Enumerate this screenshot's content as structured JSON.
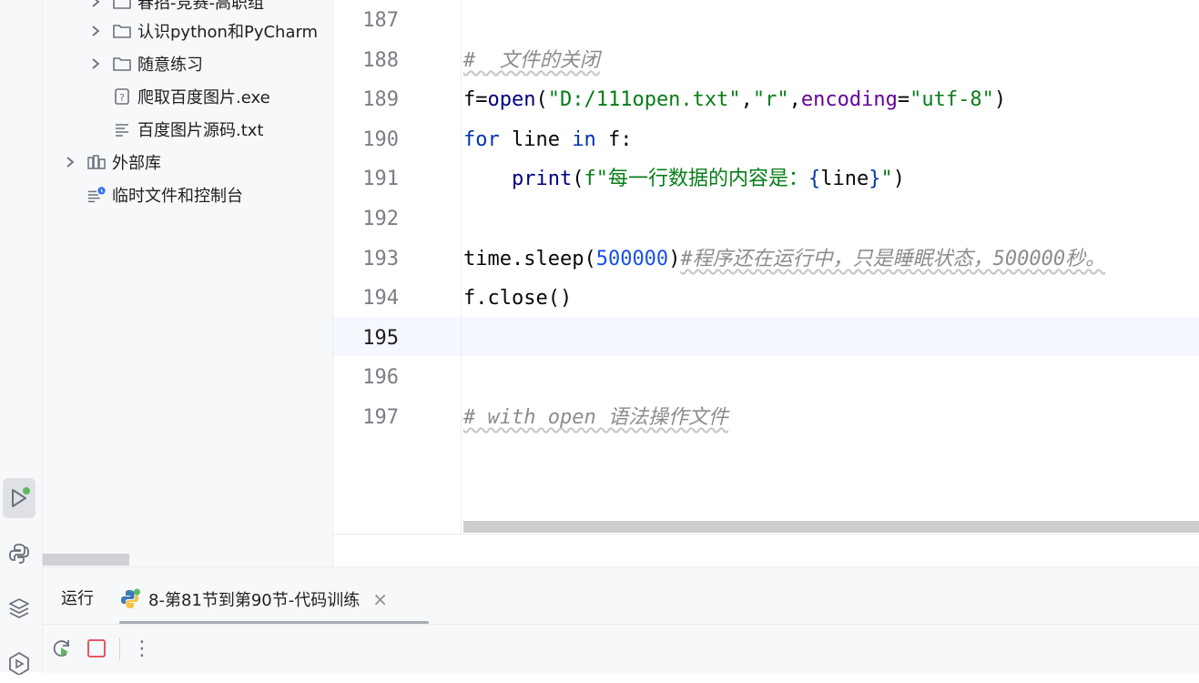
{
  "project_tree": {
    "items": [
      {
        "label": "春招-竞赛-高职组",
        "icon": "folder-icon",
        "expandable": true
      },
      {
        "label": "认识python和PyCharm",
        "icon": "folder-icon",
        "expandable": true
      },
      {
        "label": "随意练习",
        "icon": "folder-icon",
        "expandable": true
      },
      {
        "label": "爬取百度图片.exe",
        "icon": "unknown-file-icon",
        "expandable": false
      },
      {
        "label": "百度图片源码.txt",
        "icon": "text-file-icon",
        "expandable": false
      },
      {
        "label": "外部库",
        "icon": "library-icon",
        "expandable": true
      },
      {
        "label": "临时文件和控制台",
        "icon": "scratch-icon",
        "expandable": false
      }
    ]
  },
  "editor": {
    "line_numbers": [
      "187",
      "188",
      "189",
      "190",
      "191",
      "192",
      "193",
      "194",
      "195",
      "196",
      "197"
    ],
    "current_line": "195",
    "lines": {
      "l188_comment": "#  文件的关闭",
      "l189_a": "f=",
      "l189_open": "open",
      "l189_b": "(",
      "l189_s1": "\"D:/111open.txt\"",
      "l189_c1": ",",
      "l189_s2": "\"r\"",
      "l189_c2": ",",
      "l189_kw": "encoding",
      "l189_eq": "=",
      "l189_s3": "\"utf-8\"",
      "l189_end": ")",
      "l190_for": "for",
      "l190_mid": " line ",
      "l190_in": "in",
      "l190_end": " f:",
      "l191_indent": "    ",
      "l191_print": "print",
      "l191_p": "(",
      "l191_f1": "f\"每一行数据的内容是：",
      "l191_b1": "{",
      "l191_var": "line",
      "l191_b2": "}",
      "l191_f2": "\"",
      "l191_end": ")",
      "l193_a": "time.sleep(",
      "l193_num": "500000",
      "l193_b": ")",
      "l193_comment": "#程序还在运行中，只是睡眠状态，500000秒。",
      "l194": "f.close()",
      "l197_comment": "# with open 语法操作文件"
    }
  },
  "run_panel": {
    "title": "运行",
    "tab_label": "8-第81节到第90节-代码训练",
    "close_symbol": "×",
    "more_symbol": "⋮"
  },
  "colors": {
    "accent_green": "#5fb865",
    "stop_red": "#e55765",
    "python_blue": "#3d7ab8",
    "python_yellow": "#f5c342"
  }
}
